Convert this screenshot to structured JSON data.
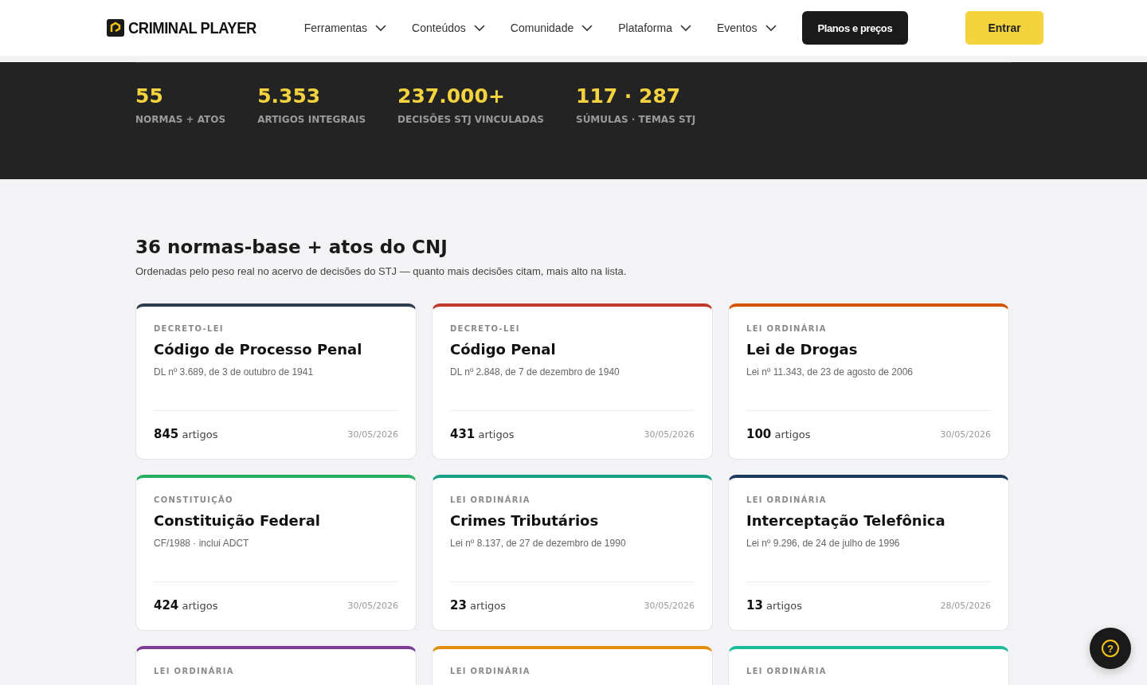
{
  "header": {
    "logo": "CRIMINAL PLAYER",
    "nav": [
      {
        "label": "Ferramentas"
      },
      {
        "label": "Conteúdos"
      },
      {
        "label": "Comunidade"
      },
      {
        "label": "Plataforma"
      },
      {
        "label": "Eventos"
      }
    ],
    "plans_button": "Planos e preços",
    "login_button": "Entrar"
  },
  "stats": [
    {
      "value": "55",
      "label": "NORMAS + ATOS"
    },
    {
      "value": "5.353",
      "label": "ARTIGOS INTEGRAIS"
    },
    {
      "value": "237.000+",
      "label": "DECISÕES STJ VINCULADAS"
    },
    {
      "value": "117 · 287",
      "label": "SÚMULAS · TEMAS STJ"
    }
  ],
  "section": {
    "title": "36 normas-base + atos do CNJ",
    "subtitle": "Ordenadas pelo peso real no acervo de decisões do STJ — quanto mais decisões citam, mais alto na lista."
  },
  "cards": [
    {
      "type": "DECRETO-LEI",
      "title": "Código de Processo Penal",
      "subtitle": "DL nº 3.689, de 3 de outubro de 1941",
      "count": "845",
      "count_unit": "artigos",
      "date": "30/05/2026",
      "color": "#2c3e50"
    },
    {
      "type": "DECRETO-LEI",
      "title": "Código Penal",
      "subtitle": "DL nº 2.848, de 7 de dezembro de 1940",
      "count": "431",
      "count_unit": "artigos",
      "date": "30/05/2026",
      "color": "#c0392b"
    },
    {
      "type": "LEI ORDINÁRIA",
      "title": "Lei de Drogas",
      "subtitle": "Lei nº 11.343, de 23 de agosto de 2006",
      "count": "100",
      "count_unit": "artigos",
      "date": "30/05/2026",
      "color": "#d35400"
    },
    {
      "type": "CONSTITUIÇÃO",
      "title": "Constituição Federal",
      "subtitle": "CF/1988 · inclui ADCT",
      "count": "424",
      "count_unit": "artigos",
      "date": "30/05/2026",
      "color": "#27ae60"
    },
    {
      "type": "LEI ORDINÁRIA",
      "title": "Crimes Tributários",
      "subtitle": "Lei nº 8.137, de 27 de dezembro de 1990",
      "count": "23",
      "count_unit": "artigos",
      "date": "30/05/2026",
      "color": "#16a085"
    },
    {
      "type": "LEI ORDINÁRIA",
      "title": "Interceptação Telefônica",
      "subtitle": "Lei nº 9.296, de 24 de julho de 1996",
      "count": "13",
      "count_unit": "artigos",
      "date": "28/05/2026",
      "color": "#1f3a5f"
    },
    {
      "type": "LEI ORDINÁRIA",
      "color": "#7d3c98"
    },
    {
      "type": "LEI ORDINÁRIA",
      "color": "#e08e0b"
    },
    {
      "type": "LEI ORDINÁRIA",
      "color": "#1abc9c"
    }
  ],
  "help_button": "?"
}
